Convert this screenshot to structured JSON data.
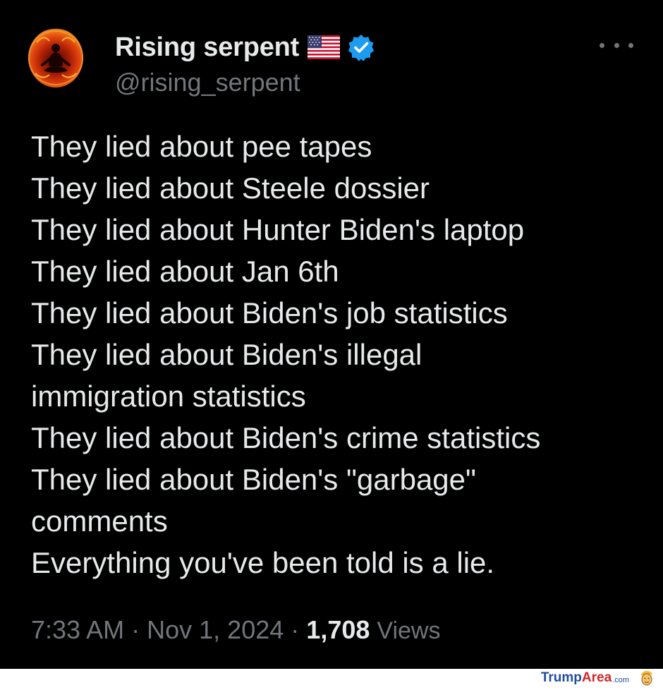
{
  "tweet": {
    "display_name": "Rising serpent",
    "handle": "@rising_serpent",
    "flag_icon": "us-flag-emoji",
    "verified_icon": "verified-badge-icon",
    "more_icon": "more-options-icon",
    "lines": [
      "They lied about pee tapes",
      "They lied about Steele dossier",
      "They lied about Hunter Biden's laptop",
      "They lied about Jan 6th",
      "They lied about Biden's job statistics",
      "They lied about Biden's illegal",
      "immigration statistics",
      "They lied about Biden's crime statistics",
      "They lied about Biden's \"garbage\"",
      "comments",
      "Everything you've been told is a lie."
    ],
    "time": "7:33 AM",
    "separator": "·",
    "date": "Nov 1, 2024",
    "views_count": "1,708",
    "views_label": "Views"
  },
  "watermark": {
    "part1": "Trump",
    "part2": "Area",
    "part3": ".com",
    "icon": "trump-face-icon"
  },
  "colors": {
    "background": "#000000",
    "text_primary": "#e7e9ea",
    "text_secondary": "#71767b",
    "verified_blue": "#1d9bf0"
  }
}
